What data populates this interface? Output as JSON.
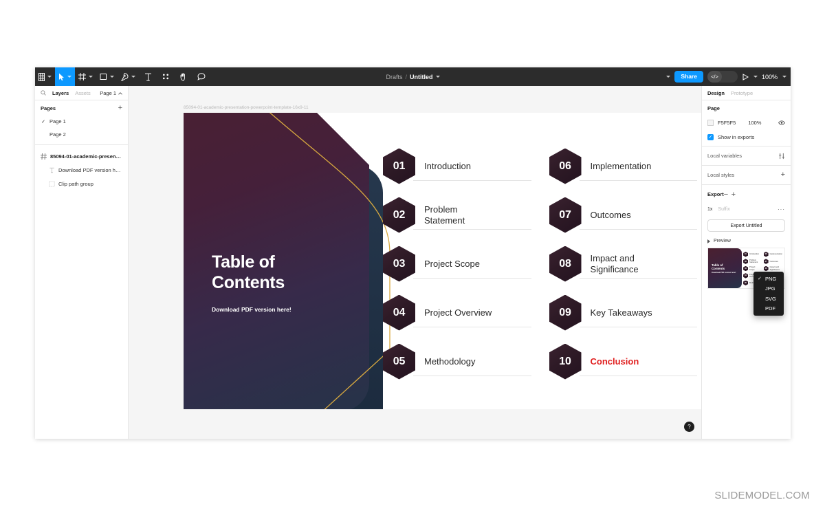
{
  "toolbar": {
    "tools": [
      {
        "name": "menu",
        "icon": "figma-logo-icon",
        "caret": true,
        "active": false
      },
      {
        "name": "move",
        "icon": "cursor-icon",
        "caret": true,
        "active": true
      },
      {
        "name": "frame",
        "icon": "frame-icon",
        "caret": true,
        "active": false
      },
      {
        "name": "shape",
        "icon": "rectangle-icon",
        "caret": true,
        "active": false
      },
      {
        "name": "pen",
        "icon": "pen-icon",
        "caret": true,
        "active": false
      },
      {
        "name": "text",
        "icon": "text-icon",
        "caret": false,
        "active": false
      },
      {
        "name": "resources",
        "icon": "plugins-icon",
        "caret": false,
        "active": false
      },
      {
        "name": "hand",
        "icon": "hand-icon",
        "caret": false,
        "active": false
      },
      {
        "name": "comment",
        "icon": "comment-icon",
        "caret": false,
        "active": false
      }
    ],
    "breadcrumb_root": "Drafts",
    "breadcrumb_sep": "/",
    "breadcrumb_current": "Untitled",
    "share_label": "Share",
    "code_label": "</>",
    "zoom_label": "100%"
  },
  "left_panel": {
    "tabs": [
      {
        "label": "Layers",
        "active": true
      },
      {
        "label": "Assets",
        "active": false
      }
    ],
    "page_selector": "Page 1",
    "pages_title": "Pages",
    "add_page_label": "+",
    "pages": [
      {
        "label": "Page 1",
        "selected": true
      },
      {
        "label": "Page 2",
        "selected": false
      }
    ],
    "layers": [
      {
        "label": "85094-01-academic-presentatio...",
        "icon": "frame-icon",
        "type": "frame"
      },
      {
        "label": "Download PDF version here!",
        "icon": "text-layer-icon",
        "type": "text"
      },
      {
        "label": "Clip path group",
        "icon": "group-icon",
        "type": "group"
      }
    ]
  },
  "canvas": {
    "frame_label": "85094-01-academic-presentation-powerpoint-template-16x9-11",
    "slide": {
      "title": "Table of\nContents",
      "title_line1": "Table of",
      "title_line2": "Contents",
      "subtitle": "Download PDF version here!",
      "accent_gold": "#d8a93f",
      "maroon": "#4b2030",
      "navy": "#26384d",
      "accent_red": "#e02020",
      "items_left": [
        {
          "num": "01",
          "label": "Introduction",
          "accent": false
        },
        {
          "num": "02",
          "label": "Problem\nStatement",
          "accent": false
        },
        {
          "num": "03",
          "label": "Project Scope",
          "accent": false
        },
        {
          "num": "04",
          "label": "Project Overview",
          "accent": false
        },
        {
          "num": "05",
          "label": "Methodology",
          "accent": false
        }
      ],
      "items_right": [
        {
          "num": "06",
          "label": "Implementation",
          "accent": false
        },
        {
          "num": "07",
          "label": "Outcomes",
          "accent": false
        },
        {
          "num": "08",
          "label": "Impact and\nSignificance",
          "accent": false
        },
        {
          "num": "09",
          "label": "Key Takeaways",
          "accent": false
        },
        {
          "num": "10",
          "label": "Conclusion",
          "accent": true
        }
      ]
    }
  },
  "right_panel": {
    "tabs": [
      {
        "label": "Design",
        "active": true
      },
      {
        "label": "Prototype",
        "active": false
      }
    ],
    "page_section_title": "Page",
    "page_color_hex": "F5F5F5",
    "page_color_opacity": "100%",
    "show_in_exports_label": "Show in exports",
    "local_variables_label": "Local variables",
    "local_styles_label": "Local styles",
    "export_label": "Export",
    "export_minus": "−",
    "export_plus": "+",
    "export_scale": "1x",
    "export_suffix_placeholder": "Suffix",
    "export_more": "···",
    "export_button_label": "Export Untitled",
    "preview_label": "Preview",
    "format_menu": [
      {
        "label": "PNG",
        "checked": true
      },
      {
        "label": "JPG",
        "checked": false
      },
      {
        "label": "SVG",
        "checked": false
      },
      {
        "label": "PDF",
        "checked": false
      }
    ],
    "preview_slide": {
      "title_line1": "Table of",
      "title_line2": "Contents",
      "subtitle": "Download PDF version here!",
      "items_left": [
        {
          "num": "01",
          "label": "Introduction"
        },
        {
          "num": "02",
          "label": "Problem Statement"
        },
        {
          "num": "03",
          "label": "Project Scope"
        },
        {
          "num": "04",
          "label": "Project Overview"
        },
        {
          "num": "05",
          "label": "Methodology"
        }
      ],
      "items_right": [
        {
          "num": "06",
          "label": "Implementation"
        },
        {
          "num": "07",
          "label": "Outcomes"
        },
        {
          "num": "08",
          "label": "Impact and Significance"
        },
        {
          "num": "09",
          "label": "Key Takeaways"
        },
        {
          "num": "10",
          "label": "Conclusion",
          "accent": true
        }
      ]
    }
  },
  "help_button_label": "?",
  "watermark": "SLIDEMODEL.COM"
}
